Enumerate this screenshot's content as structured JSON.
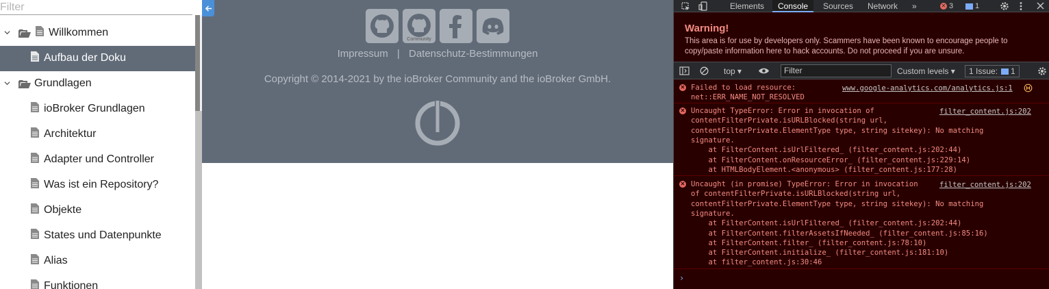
{
  "sidebar": {
    "filter_placeholder": "Filter",
    "items": [
      {
        "label": "Willkommen",
        "type": "folder",
        "expanded": true
      },
      {
        "label": "Aufbau der Doku",
        "type": "doc",
        "active": true
      },
      {
        "label": "Grundlagen",
        "type": "folder",
        "expanded": true
      },
      {
        "label": "ioBroker Grundlagen",
        "type": "doc"
      },
      {
        "label": "Architektur",
        "type": "doc"
      },
      {
        "label": "Adapter und Controller",
        "type": "doc"
      },
      {
        "label": "Was ist ein Repository?",
        "type": "doc"
      },
      {
        "label": "Objekte",
        "type": "doc"
      },
      {
        "label": "States und Datenpunkte",
        "type": "doc"
      },
      {
        "label": "Alias",
        "type": "doc"
      },
      {
        "label": "Funktionen",
        "type": "doc"
      }
    ]
  },
  "footer": {
    "social": [
      {
        "name": "github-icon",
        "tag": ""
      },
      {
        "name": "github-community-icon",
        "tag": "Community"
      },
      {
        "name": "facebook-icon",
        "tag": ""
      },
      {
        "name": "discord-icon",
        "tag": ""
      }
    ],
    "impressum": "Impressum",
    "separator": "|",
    "datenschutz": "Datenschutz-Bestimmungen",
    "copyright": "Copyright © 2014-2021 by the ioBroker Community and the ioBroker GmbH."
  },
  "devtools": {
    "tabs": [
      "Elements",
      "Console",
      "Sources",
      "Network",
      "»"
    ],
    "active_tab": "Console",
    "error_count": "3",
    "info_count": "1",
    "warning_title": "Warning!",
    "warning_text": "This area is for use by developers only. Scammers have been known to encourage people to copy/paste information here to hack accounts. Do not proceed if you are unsure.",
    "context": "top ▾",
    "filter_placeholder": "Filter",
    "levels": "Custom levels ▾",
    "issues": "1 Issue:",
    "issues_count": "1",
    "messages": [
      {
        "lines": [
          "Failed to load resource:",
          "net::ERR_NAME_NOT_RESOLVED"
        ],
        "source": "www.google-analytics.com/analytics.js:1"
      },
      {
        "lines": [
          "Uncaught TypeError: Error in invocation of",
          "contentFilterPrivate.isURLBlocked(string url,",
          "contentFilterPrivate.ElementType type, string sitekey): No matching",
          "signature.",
          "    at FilterContent.isUrlFiltered_ (filter_content.js:202:44)",
          "    at FilterContent.onResourceError_ (filter_content.js:229:14)",
          "    at HTMLBodyElement.<anonymous> (filter_content.js:177:28)"
        ],
        "source": "filter_content.js:202"
      },
      {
        "lines": [
          "Uncaught (in promise) TypeError: Error in invocation",
          "of contentFilterPrivate.isURLBlocked(string url,",
          "contentFilterPrivate.ElementType type, string sitekey): No matching",
          "signature.",
          "    at FilterContent.isUrlFiltered_ (filter_content.js:202:44)",
          "    at FilterContent.filterAssetsIfNeeded_ (filter_content.js:85:16)",
          "    at FilterContent.filter_ (filter_content.js:78:10)",
          "    at FilterContent.initialize_ (filter_content.js:181:10)",
          "    at filter_content.js:30:46"
        ],
        "source": "filter_content.js:202"
      }
    ],
    "prompt": "›"
  },
  "colors": {
    "active_row": "#616b78",
    "footer_bg": "#616b78",
    "devtools_error_bg": "#290000",
    "error_text": "#f28b82",
    "accent": "#7cacf8"
  }
}
